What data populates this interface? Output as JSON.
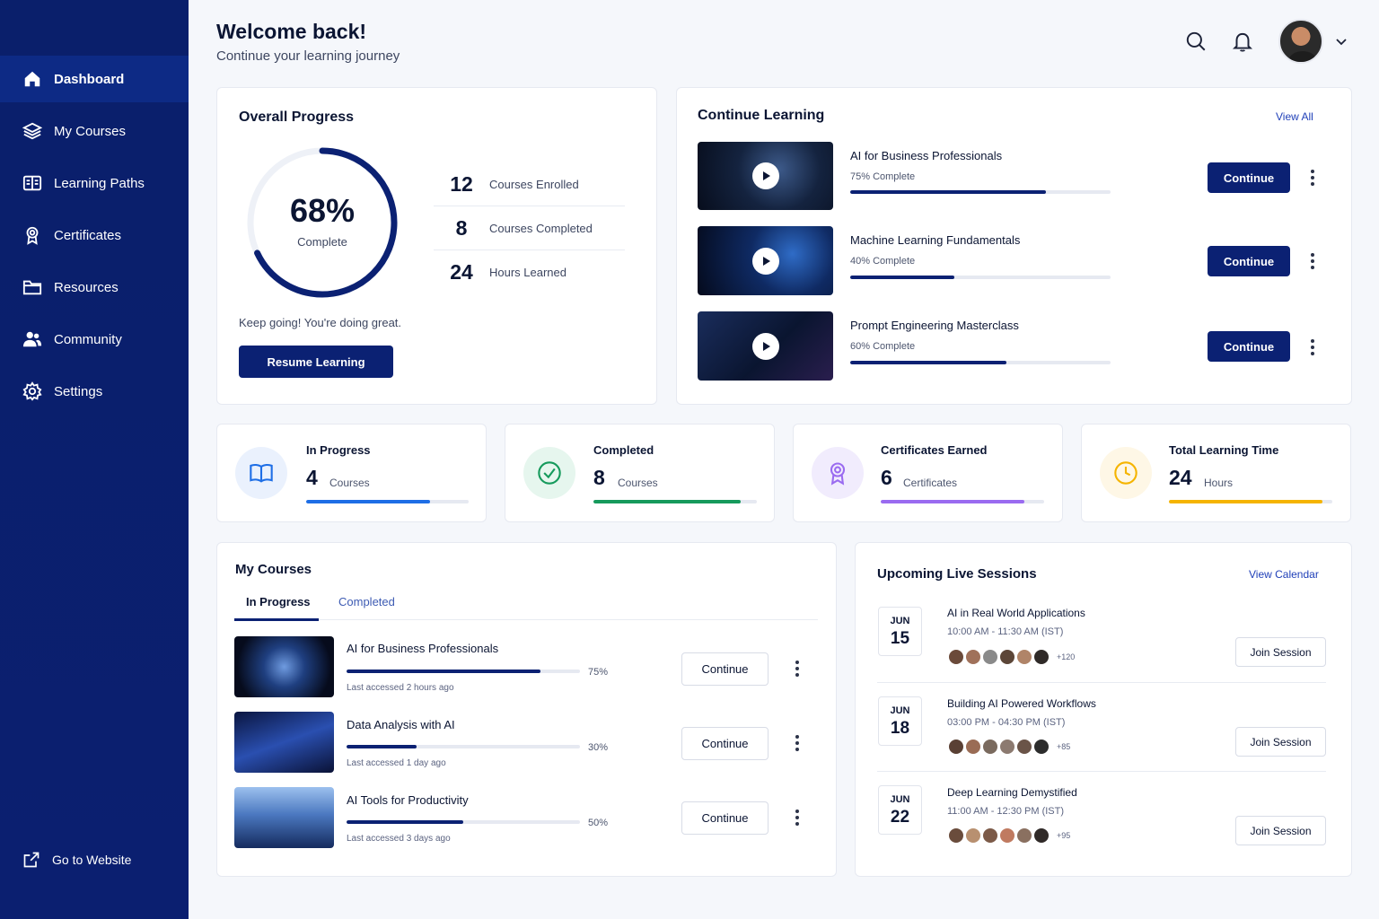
{
  "sidebar": {
    "items": [
      {
        "label": "Dashboard",
        "icon": "home-icon"
      },
      {
        "label": "My Courses",
        "icon": "layers-icon"
      },
      {
        "label": "Learning Paths",
        "icon": "map-icon"
      },
      {
        "label": "Certificates",
        "icon": "award-icon"
      },
      {
        "label": "Resources",
        "icon": "folder-icon"
      },
      {
        "label": "Community",
        "icon": "users-icon"
      },
      {
        "label": "Settings",
        "icon": "gear-icon"
      }
    ],
    "footer_link": "Go to Website"
  },
  "header": {
    "title": "Welcome back!",
    "subtitle": "Continue your learning journey"
  },
  "overall": {
    "title": "Overall Progress",
    "percent": 68,
    "percent_label": "68%",
    "complete_label": "Complete",
    "stats": [
      {
        "value": "12",
        "label": "Courses Enrolled"
      },
      {
        "value": "8",
        "label": "Courses Completed"
      },
      {
        "value": "24",
        "label": "Hours Learned"
      }
    ],
    "message": "Keep going! You're doing great.",
    "button": "Resume Learning"
  },
  "continue_learning": {
    "title": "Continue Learning",
    "view_all": "View All",
    "button": "Continue",
    "items": [
      {
        "title": "AI for Business Professionals",
        "progress_label": "75% Complete",
        "progress": 0.75
      },
      {
        "title": "Machine Learning Fundamentals",
        "progress_label": "40% Complete",
        "progress": 0.4
      },
      {
        "title": "Prompt Engineering Masterclass",
        "progress_label": "60% Complete",
        "progress": 0.6
      }
    ]
  },
  "stat_cards": [
    {
      "label": "In Progress",
      "value": "4",
      "unit": "Courses",
      "progress": 0.76,
      "color": "#1e6ee6",
      "bg": "#eaf1fd"
    },
    {
      "label": "Completed",
      "value": "8",
      "unit": "Courses",
      "progress": 0.9,
      "color": "#169a5c",
      "bg": "#e6f6ee"
    },
    {
      "label": "Certificates Earned",
      "value": "6",
      "unit": "Certificates",
      "progress": 0.88,
      "color": "#9a6bf0",
      "bg": "#f1ecfd"
    },
    {
      "label": "Total Learning Time",
      "value": "24",
      "unit": "Hours",
      "progress": 0.94,
      "color": "#f5b400",
      "bg": "#fef7e6"
    }
  ],
  "my_courses": {
    "title": "My Courses",
    "tabs": [
      "In Progress",
      "Completed"
    ],
    "button": "Continue",
    "items": [
      {
        "title": "AI for Business Professionals",
        "pct_label": "75%",
        "progress": 0.83,
        "last": "Last accessed 2 hours ago"
      },
      {
        "title": "Data Analysis with AI",
        "pct_label": "30%",
        "progress": 0.3,
        "last": "Last accessed 1 day ago"
      },
      {
        "title": "AI Tools for Productivity",
        "pct_label": "50%",
        "progress": 0.5,
        "last": "Last accessed 3 days ago"
      }
    ]
  },
  "sessions": {
    "title": "Upcoming Live Sessions",
    "view_calendar": "View Calendar",
    "button": "Join Session",
    "items": [
      {
        "month": "JUN",
        "day": "15",
        "title": "AI in Real World Applications",
        "time": "10:00 AM - 11:30 AM (IST)",
        "more": "+120"
      },
      {
        "month": "JUN",
        "day": "18",
        "title": "Building AI Powered Workflows",
        "time": "03:00 PM - 04:30 PM (IST)",
        "more": "+85"
      },
      {
        "month": "JUN",
        "day": "22",
        "title": "Deep Learning Demystified",
        "time": "11:00 AM - 12:30 PM (IST)",
        "more": "+95"
      }
    ]
  },
  "colors": {
    "brand": "#0b2173",
    "sidebar": "#0a1f6b",
    "accent_link": "#1f3fb8"
  }
}
